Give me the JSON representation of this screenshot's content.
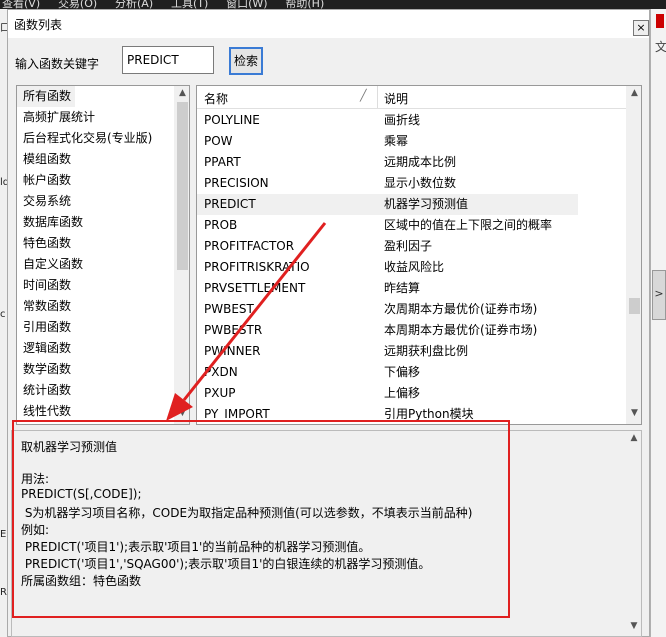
{
  "menubar": {
    "items": [
      "查看(V)",
      "交易(O)",
      "分析(A)",
      "工具(T)",
      "窗口(W)",
      "帮助(H)"
    ]
  },
  "dialog": {
    "title": "函数列表",
    "close_glyph": "×",
    "search": {
      "label": "输入函数关键字",
      "value": "PREDICT",
      "button": "检索"
    }
  },
  "categories": [
    {
      "label": "所有函数",
      "selected": true
    },
    {
      "label": "高频扩展统计"
    },
    {
      "label": "后台程式化交易(专业版)"
    },
    {
      "label": "模组函数"
    },
    {
      "label": "帐户函数"
    },
    {
      "label": "交易系统"
    },
    {
      "label": "数据库函数"
    },
    {
      "label": "特色函数"
    },
    {
      "label": "自定义函数"
    },
    {
      "label": "时间函数"
    },
    {
      "label": "常数函数"
    },
    {
      "label": "引用函数"
    },
    {
      "label": "逻辑函数"
    },
    {
      "label": "数学函数"
    },
    {
      "label": "统计函数"
    },
    {
      "label": "线性代数"
    }
  ],
  "table": {
    "columns": [
      "名称",
      "说明"
    ],
    "rows": [
      {
        "name": "POLYLINE",
        "desc": "画折线"
      },
      {
        "name": "POW",
        "desc": "乘幂"
      },
      {
        "name": "PPART",
        "desc": "远期成本比例"
      },
      {
        "name": "PRECISION",
        "desc": "显示小数位数"
      },
      {
        "name": "PREDICT",
        "desc": "机器学习预测值",
        "selected": true
      },
      {
        "name": "PROB",
        "desc": "区域中的值在上下限之间的概率"
      },
      {
        "name": "PROFITFACTOR",
        "desc": "盈利因子"
      },
      {
        "name": "PROFITRISKRATIO",
        "desc": "收益风险比"
      },
      {
        "name": "PRVSETTLEMENT",
        "desc": "昨结算"
      },
      {
        "name": "PWBEST",
        "desc": "次周期本方最优价(证券市场)"
      },
      {
        "name": "PWBESTR",
        "desc": "本周期本方最优价(证券市场)"
      },
      {
        "name": "PWINNER",
        "desc": "远期获利盘比例"
      },
      {
        "name": "PXDN",
        "desc": "下偏移"
      },
      {
        "name": "PXUP",
        "desc": "上偏移"
      },
      {
        "name": "PY_IMPORT",
        "desc": "引用Python模块"
      }
    ]
  },
  "detail": {
    "lines": [
      "取机器学习预测值",
      "",
      "用法:",
      "PREDICT(S[,CODE]);",
      " S为机器学习项目名称，CODE为取指定品种预测值(可以选参数，不填表示当前品种)",
      "例如:",
      " PREDICT('项目1');表示取'项目1'的当前品种的机器学习预测值。",
      " PREDICT('项目1','SQAG00');表示取'项目1'的白银连续的机器学习预测值。",
      "所属函数组：特色函数"
    ]
  },
  "side": {
    "left_labels": [
      "口",
      "ld",
      "c",
      "E",
      "R"
    ],
    "right_text": "文",
    "expand_glyph": ">"
  },
  "annotation_color": "#e02020"
}
